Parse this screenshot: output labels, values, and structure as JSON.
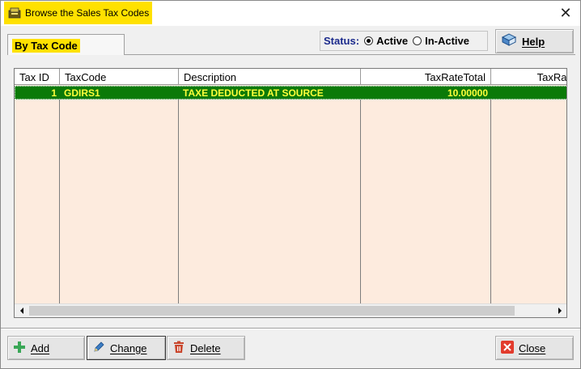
{
  "window": {
    "title": "Browse the Sales Tax Codes",
    "close_glyph": "✕"
  },
  "tabs": [
    {
      "label": "By Tax Code",
      "active": true
    }
  ],
  "status": {
    "label": "Status:",
    "options": [
      {
        "label": "Active",
        "selected": true
      },
      {
        "label": "In-Active",
        "selected": false
      }
    ]
  },
  "help_button": {
    "label": "Help",
    "icon": "help-book-icon"
  },
  "grid": {
    "columns": [
      "Tax ID",
      "TaxCode",
      "Description",
      "TaxRateTotal",
      "TaxRateS"
    ],
    "rows": [
      {
        "tax_id": "1",
        "tax_code": "GDIRS1",
        "description": "TAXE DEDUCTED AT SOURCE",
        "tax_rate_total": "10.00000",
        "tax_rate_s": ""
      }
    ],
    "selected_row_color": "#0b7a08",
    "selected_text_color": "#ffff3a",
    "background_color": "#fdebde"
  },
  "buttons": {
    "add": {
      "label": "Add",
      "icon": "plus-icon"
    },
    "change": {
      "label": "Change",
      "icon": "pencil-icon"
    },
    "delete": {
      "label": "Delete",
      "icon": "trash-icon"
    },
    "close": {
      "label": "Close",
      "icon": "close-x-icon"
    }
  },
  "colors": {
    "title_highlight": "#ffe100",
    "status_label": "#1b2a8c"
  }
}
